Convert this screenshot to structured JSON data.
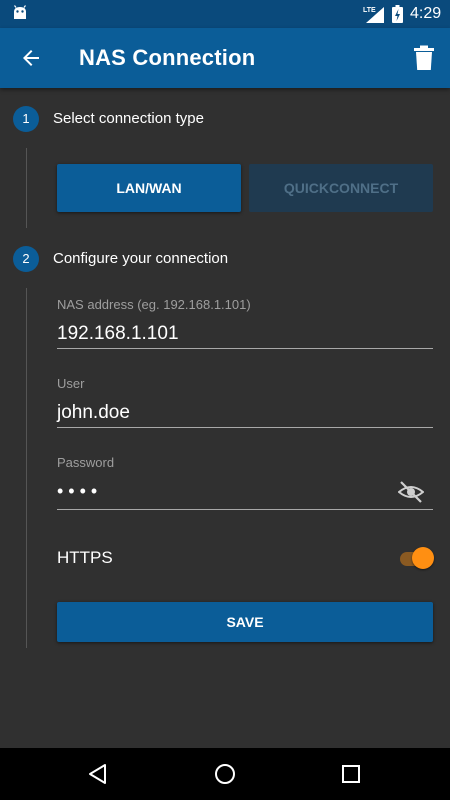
{
  "status_bar": {
    "time": "4:29",
    "network_label": "LTE",
    "icons": [
      "android-debug-icon",
      "lte-signal-icon",
      "battery-charging-icon"
    ]
  },
  "app_bar": {
    "title": "NAS Connection",
    "icons": [
      "back-arrow-icon",
      "trash-icon"
    ]
  },
  "step1": {
    "number": "1",
    "title": "Select connection type",
    "options": [
      {
        "label": "LAN/WAN",
        "selected": true
      },
      {
        "label": "QUICKCONNECT",
        "selected": false
      }
    ]
  },
  "step2": {
    "number": "2",
    "title": "Configure your connection",
    "fields": {
      "address": {
        "label": "NAS address (eg. 192.168.1.101)",
        "value": "192.168.1.101"
      },
      "user": {
        "label": "User",
        "value": "john.doe"
      },
      "password": {
        "label": "Password",
        "value": "••••",
        "visibility_icon": "visibility-off-icon"
      }
    },
    "https": {
      "label": "HTTPS",
      "enabled": true
    },
    "save_label": "SAVE"
  },
  "nav_bar": {
    "icons": [
      "nav-back-icon",
      "nav-home-icon",
      "nav-recents-icon"
    ]
  },
  "colors": {
    "primary": "#0b5d98",
    "status_bar": "#0a4a7c",
    "background": "#303030",
    "accent": "#ff8f12",
    "inactive_button": "#1f3a50"
  }
}
